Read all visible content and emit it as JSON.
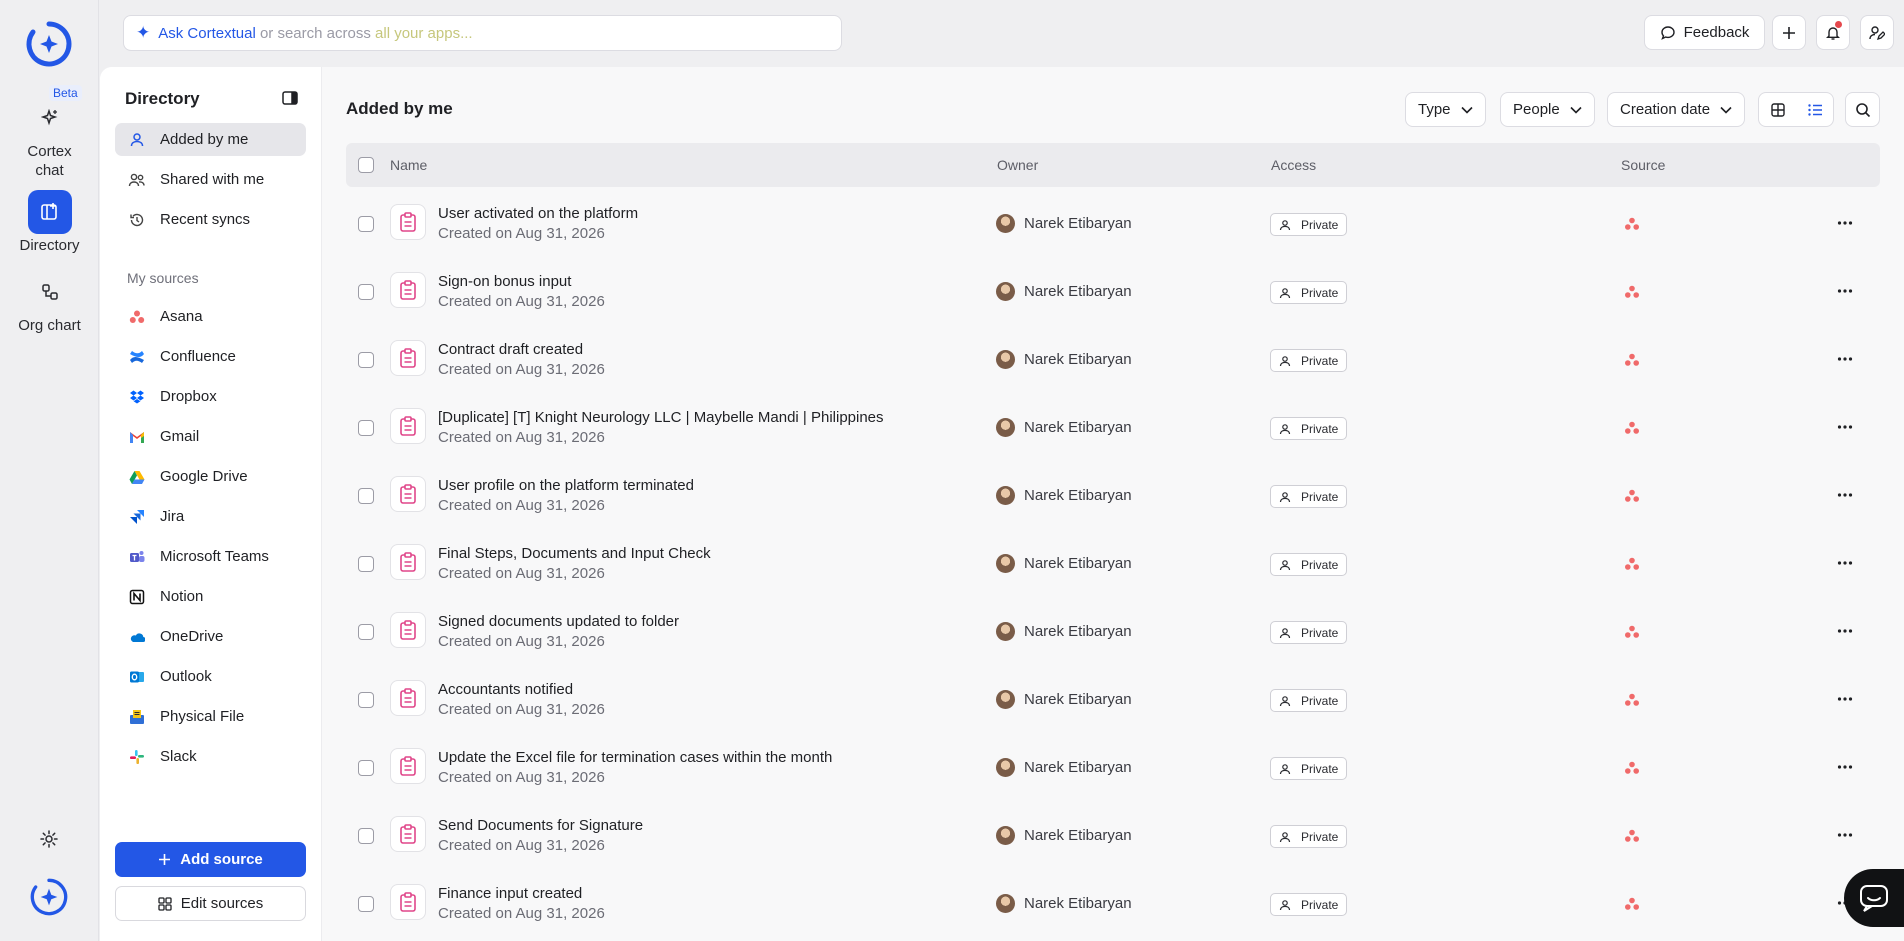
{
  "rail": {
    "items": [
      {
        "label": "Cortex chat",
        "badge": "Beta"
      },
      {
        "label": "Directory"
      },
      {
        "label": "Org chart"
      }
    ]
  },
  "topbar": {
    "search_ph1": "Ask Cortextual",
    "search_ph2": " or search across ",
    "search_ph3": "all your apps...",
    "feedback_label": "Feedback"
  },
  "sidebar": {
    "title": "Directory",
    "nav": [
      {
        "label": "Added by me"
      },
      {
        "label": "Shared with me"
      },
      {
        "label": "Recent syncs"
      }
    ],
    "section_label": "My sources",
    "sources": [
      {
        "label": "Asana",
        "icon": "asana-icon"
      },
      {
        "label": "Confluence",
        "icon": "confluence-icon"
      },
      {
        "label": "Dropbox",
        "icon": "dropbox-icon"
      },
      {
        "label": "Gmail",
        "icon": "gmail-icon"
      },
      {
        "label": "Google Drive",
        "icon": "google-drive-icon"
      },
      {
        "label": "Jira",
        "icon": "jira-icon"
      },
      {
        "label": "Microsoft Teams",
        "icon": "microsoft-teams-icon"
      },
      {
        "label": "Notion",
        "icon": "notion-icon"
      },
      {
        "label": "OneDrive",
        "icon": "onedrive-icon"
      },
      {
        "label": "Outlook",
        "icon": "outlook-icon"
      },
      {
        "label": "Physical File",
        "icon": "physical-file-icon"
      },
      {
        "label": "Slack",
        "icon": "slack-icon"
      }
    ],
    "add_source_label": "Add source",
    "edit_sources_label": "Edit sources"
  },
  "main": {
    "title": "Added by me",
    "filters": {
      "type": "Type",
      "people": "People",
      "creation_date": "Creation date"
    },
    "columns": {
      "name": "Name",
      "owner": "Owner",
      "access": "Access",
      "source": "Source"
    },
    "rows": [
      {
        "name": "User activated on the platform",
        "created": "Created on Aug 31, 2026",
        "owner": "Narek Etibaryan",
        "access": "Private"
      },
      {
        "name": "Sign-on bonus input",
        "created": "Created on Aug 31, 2026",
        "owner": "Narek Etibaryan",
        "access": "Private"
      },
      {
        "name": "Contract draft created",
        "created": "Created on Aug 31, 2026",
        "owner": "Narek Etibaryan",
        "access": "Private"
      },
      {
        "name": "[Duplicate] [T] Knight Neurology LLC | Maybelle Mandi | Philippines",
        "created": "Created on Aug 31, 2026",
        "owner": "Narek Etibaryan",
        "access": "Private"
      },
      {
        "name": "User profile on the platform terminated",
        "created": "Created on Aug 31, 2026",
        "owner": "Narek Etibaryan",
        "access": "Private"
      },
      {
        "name": "Final Steps, Documents and Input Check",
        "created": "Created on Aug 31, 2026",
        "owner": "Narek Etibaryan",
        "access": "Private"
      },
      {
        "name": "Signed documents updated to folder",
        "created": "Created on Aug 31, 2026",
        "owner": "Narek Etibaryan",
        "access": "Private"
      },
      {
        "name": "Accountants notified",
        "created": "Created on Aug 31, 2026",
        "owner": "Narek Etibaryan",
        "access": "Private"
      },
      {
        "name": "Update the Excel file for termination cases within the month",
        "created": "Created on Aug 31, 2026",
        "owner": "Narek Etibaryan",
        "access": "Private"
      },
      {
        "name": "Send Documents for Signature",
        "created": "Created on Aug 31, 2026",
        "owner": "Narek Etibaryan",
        "access": "Private"
      },
      {
        "name": "Finance input created",
        "created": "Created on Aug 31, 2026",
        "owner": "Narek Etibaryan",
        "access": "Private"
      }
    ]
  },
  "colors": {
    "accent": "#2357e6",
    "asana": "#f06a6a",
    "file_icon": "#e0478a"
  }
}
